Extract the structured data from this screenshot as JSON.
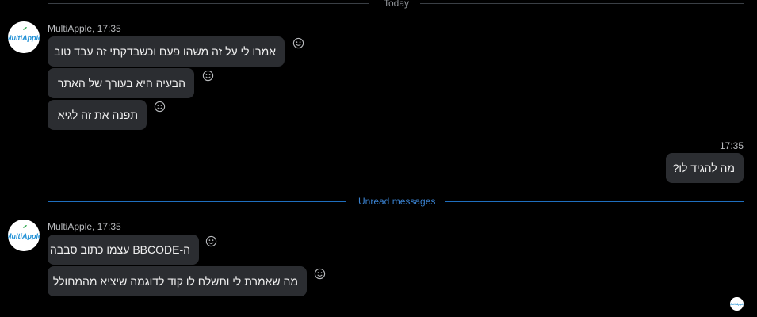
{
  "dividers": {
    "today": "Today",
    "unread": "Unread messages"
  },
  "groups": [
    {
      "author": "MultiApple",
      "time": "17:35",
      "header": "MultiApple, 17:35",
      "messages": [
        "אמרו לי על זה משהו פעם וכשבדקתי זה עבד טוב",
        "הבעיה היא בעורך של האתר",
        "תפנה את זה לגיא"
      ]
    },
    {
      "author": "me",
      "time": "17:35",
      "messages": [
        "מה להגיד לו?"
      ]
    },
    {
      "author": "MultiApple",
      "time": "17:35",
      "header": "MultiApple, 17:35",
      "messages": [
        "ה-BBCODE עצמו כתוב סבבה",
        "מה שאמרת לי ותשלח לו קוד לדוגמה שיציא מהמחולל"
      ]
    }
  ],
  "avatar": {
    "brand_text": "MultiApple",
    "brand_color": "#1e8fd5"
  },
  "colors": {
    "background": "#000000",
    "bubble": "#2b2d31",
    "unread_accent": "#1f6fbf"
  },
  "icons": {
    "reaction": "smiley-icon"
  }
}
